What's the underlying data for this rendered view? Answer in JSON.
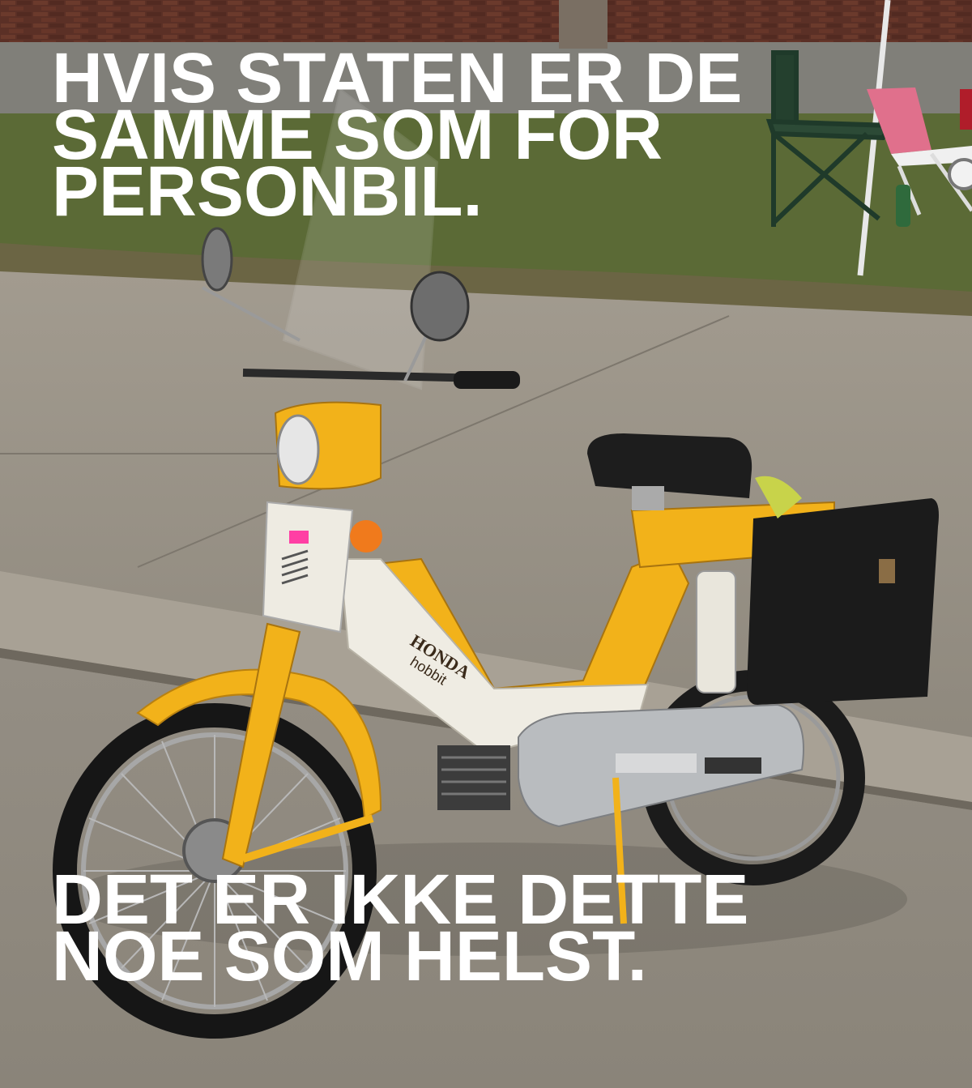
{
  "meme": {
    "top_text": "HVIS STATEN ER DE\nSAMME SOM FOR\nPERSONBIL.",
    "bottom_text": "DET ER IKKE DETTE\nNOE SOM HELST."
  },
  "photo": {
    "subject": "yellow moped on sidewalk",
    "brand_badge": "HONDA",
    "model_badge": "hobbit",
    "colors": {
      "bike_yellow": "#f2b21a",
      "panel_white": "#efece3",
      "pavement": "#9c968b",
      "grass": "#5d6a3a",
      "brick": "#5a2f25",
      "caption": "#ffffff"
    }
  }
}
